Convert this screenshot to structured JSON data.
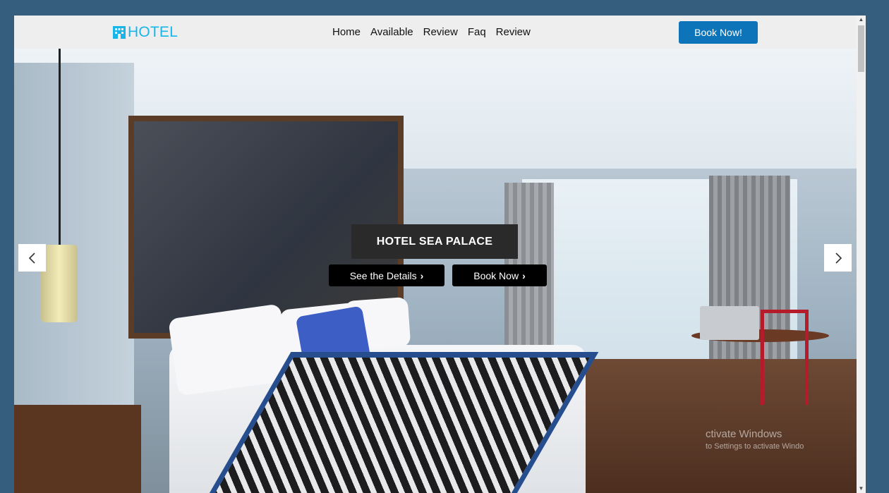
{
  "brand": {
    "name": "HOTEL",
    "icon": "hotel-building-icon",
    "color": "#17b5e8"
  },
  "nav": {
    "links": [
      "Home",
      "Available",
      "Review",
      "Faq",
      "Review"
    ],
    "cta": "Book Now!"
  },
  "hero": {
    "title": "HOTEL SEA PALACE",
    "details_button": "See the Details",
    "book_button": "Book Now",
    "chevron": "›",
    "prev_icon": "chevron-left-icon",
    "next_icon": "chevron-right-icon"
  },
  "watermark": {
    "line1": "ctivate Windows",
    "line2": "to Settings to activate Windo"
  },
  "colors": {
    "page_bg": "#355d7e",
    "cta_bg": "#0e74b9",
    "navbar_bg": "#efeeef"
  }
}
